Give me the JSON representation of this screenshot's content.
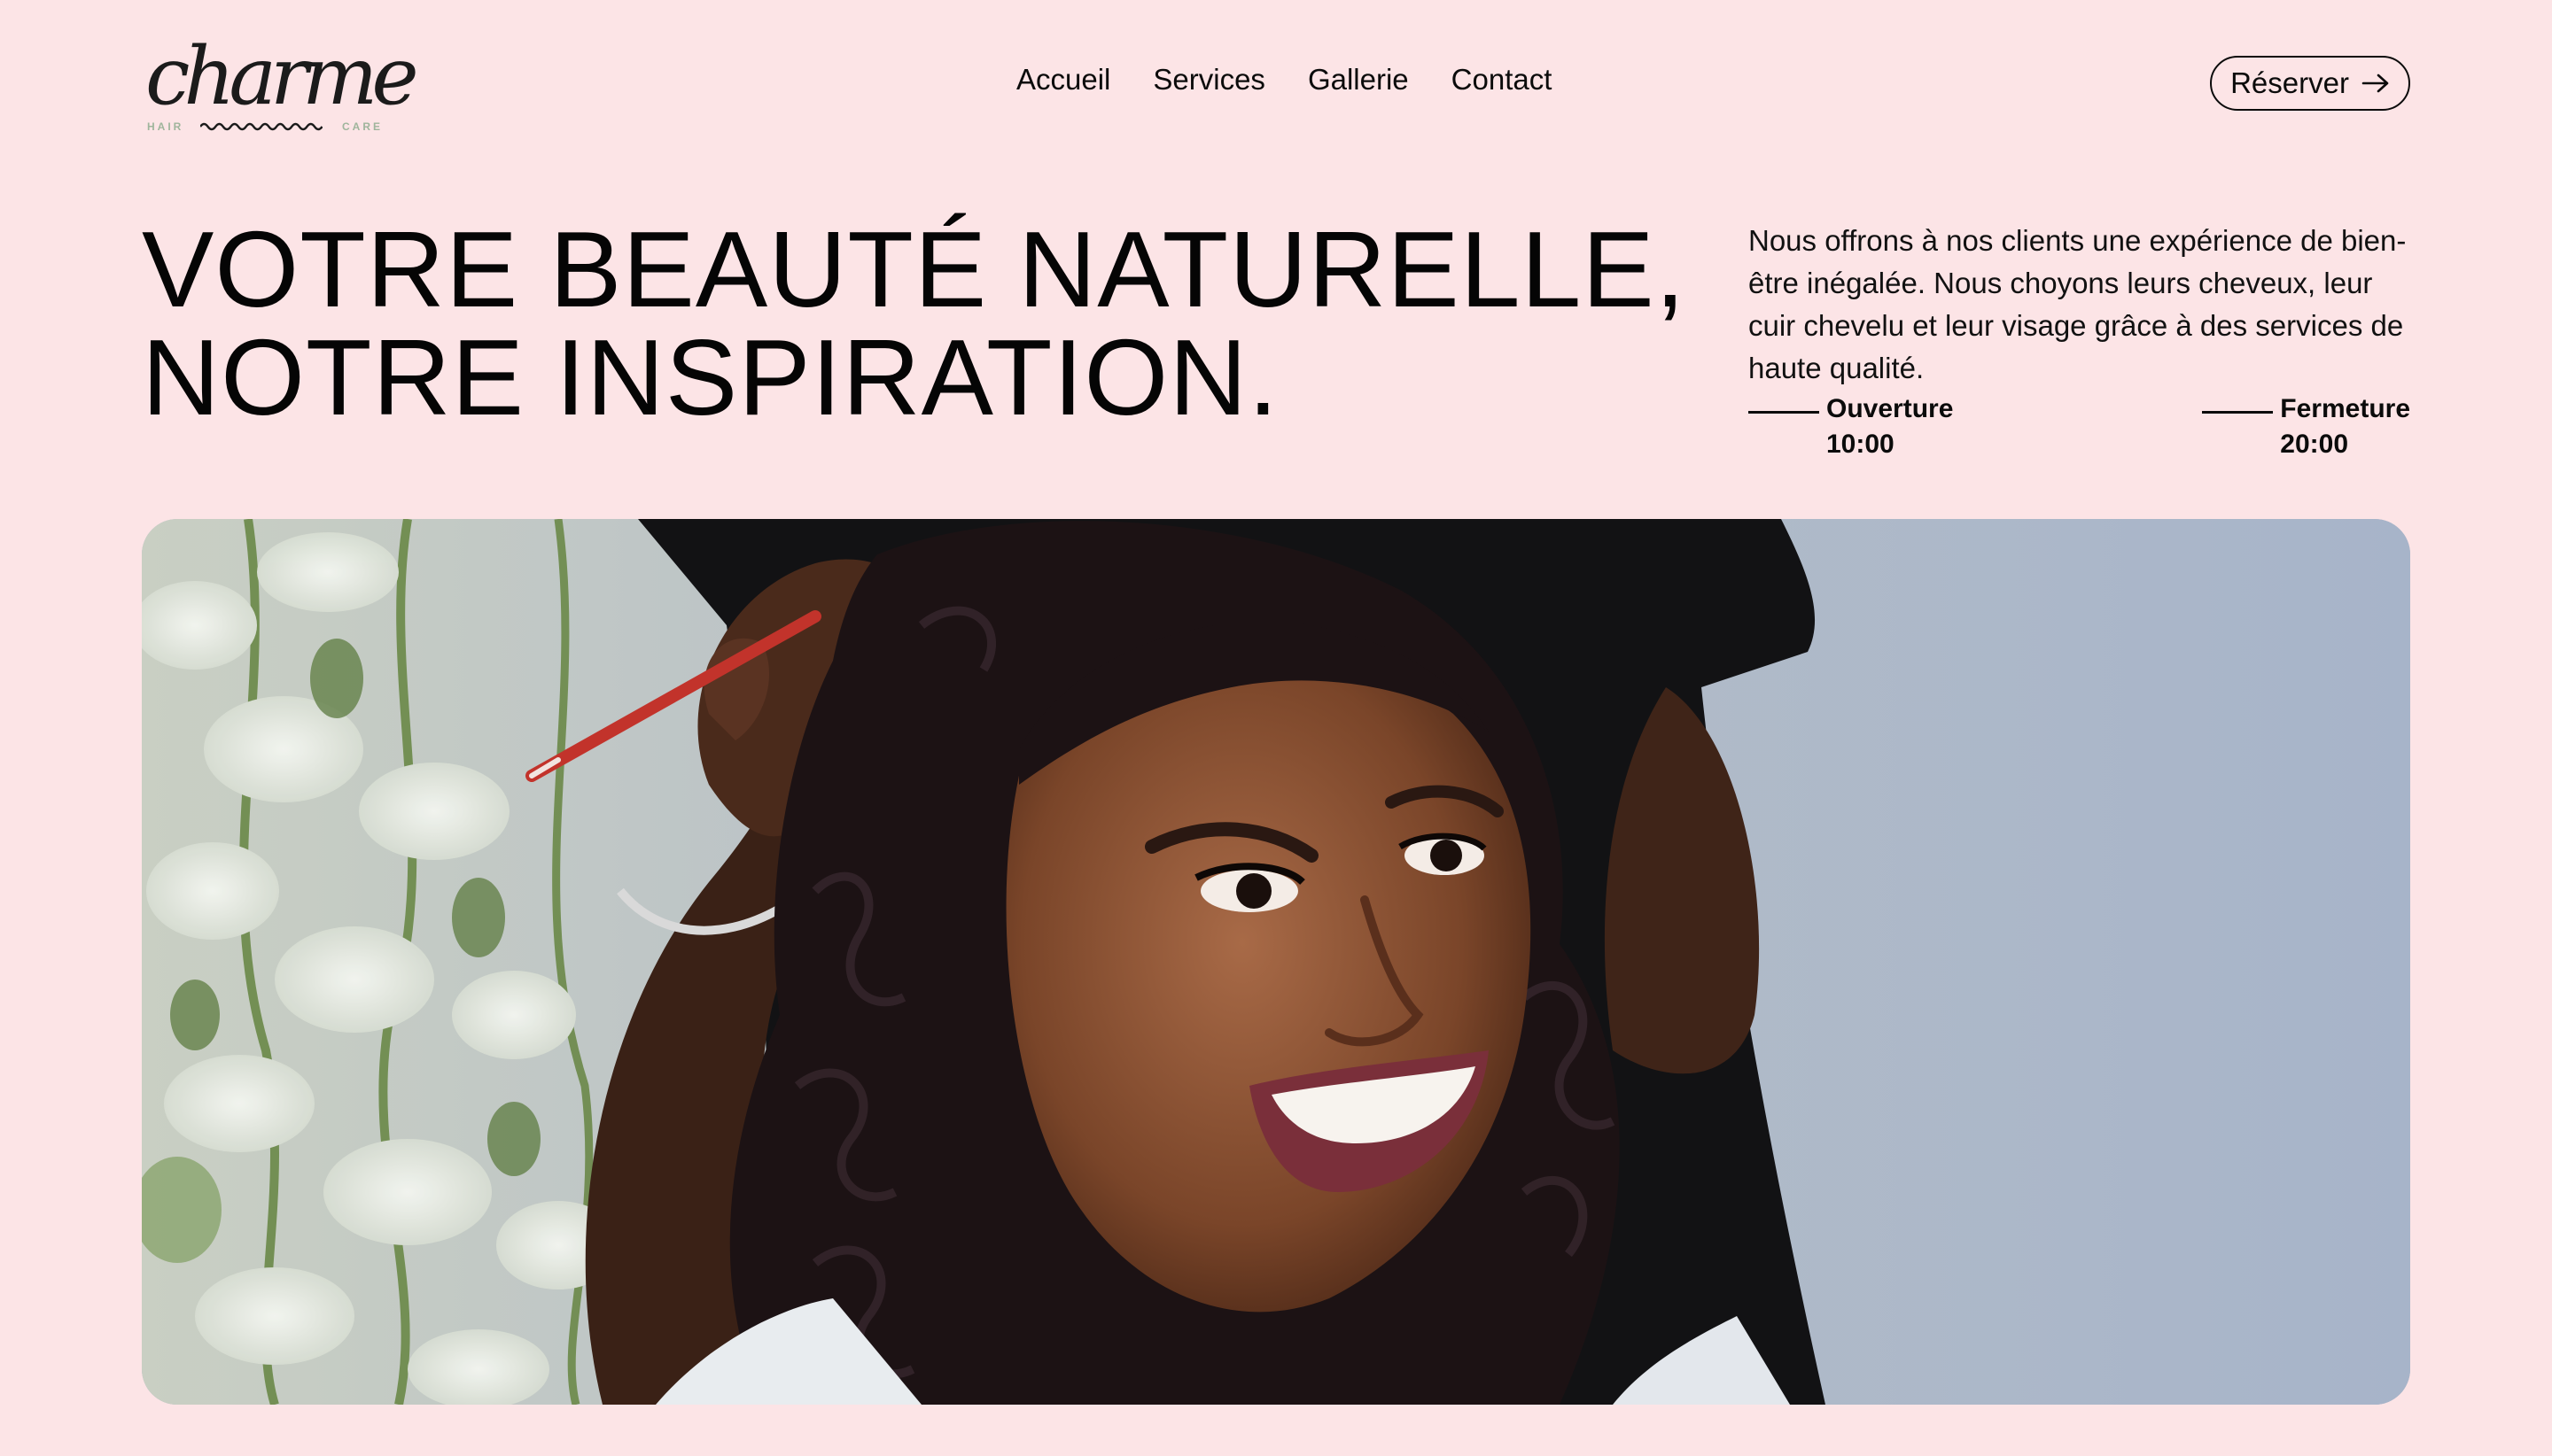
{
  "brand": {
    "name": "charme",
    "tagline_left": "HAIR",
    "tagline_right": "CARE",
    "accent_color": "#9fb59c"
  },
  "nav": {
    "items": [
      {
        "label": "Accueil"
      },
      {
        "label": "Services"
      },
      {
        "label": "Gallerie"
      },
      {
        "label": "Contact"
      }
    ]
  },
  "cta": {
    "label": "Réserver",
    "icon": "arrow-right-icon"
  },
  "hero": {
    "title_line1": "VOTRE BEAUTÉ NATURELLE,",
    "title_line2": "NOTRE INSPIRATION.",
    "intro": "Nous offrons à nos clients une expérience de bien-être inégalée. Nous choyons leurs cheveux, leur cuir chevelu et leur visage grâce à des services de haute qualité.",
    "hours": {
      "open_label": "Ouverture",
      "open_time": "10:00",
      "close_label": "Fermeture",
      "close_time": "20:00"
    },
    "image": "photo-woman-smiling-hairstylist"
  },
  "colors": {
    "background": "#fce4e6",
    "text": "#0b0b0b"
  }
}
